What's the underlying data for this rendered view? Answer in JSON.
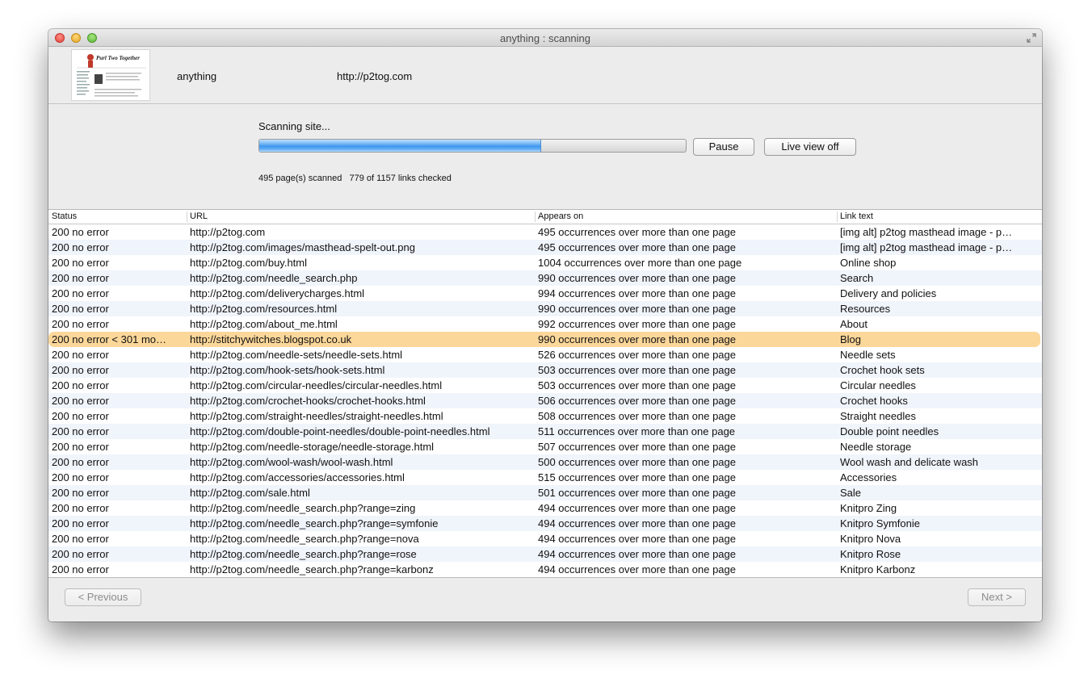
{
  "window": {
    "title": "anything : scanning"
  },
  "project": {
    "name": "anything",
    "url": "http://p2tog.com",
    "thumbnail_heading": "Purl Two Together"
  },
  "scan": {
    "status_label": "Scanning site...",
    "progress": 0.66,
    "pause_label": "Pause",
    "live_view_label": "Live view off",
    "stats": "495 page(s) scanned   779 of 1157 links checked"
  },
  "table": {
    "columns": [
      "Status",
      "URL",
      "Appears on",
      "Link text"
    ],
    "selected_row": 7,
    "rows": [
      {
        "status": "200 no error",
        "url": "http://p2tog.com",
        "appears": "495 occurrences over more than one page",
        "text": "[img alt] p2tog masthead image - p…"
      },
      {
        "status": "200 no error",
        "url": "http://p2tog.com/images/masthead-spelt-out.png",
        "appears": "495 occurrences over more than one page",
        "text": "[img alt] p2tog masthead image - p…"
      },
      {
        "status": "200 no error",
        "url": "http://p2tog.com/buy.html",
        "appears": "1004 occurrences over more than one page",
        "text": "Online shop"
      },
      {
        "status": "200 no error",
        "url": "http://p2tog.com/needle_search.php",
        "appears": "990 occurrences over more than one page",
        "text": "Search"
      },
      {
        "status": "200 no error",
        "url": "http://p2tog.com/deliverycharges.html",
        "appears": "994 occurrences over more than one page",
        "text": "Delivery and policies"
      },
      {
        "status": "200 no error",
        "url": "http://p2tog.com/resources.html",
        "appears": "990 occurrences over more than one page",
        "text": "Resources"
      },
      {
        "status": "200 no error",
        "url": "http://p2tog.com/about_me.html",
        "appears": "992 occurrences over more than one page",
        "text": "About"
      },
      {
        "status": "200 no error < 301 mo…",
        "url": "http://stitchywitches.blogspot.co.uk",
        "appears": "990 occurrences over more than one page",
        "text": "Blog"
      },
      {
        "status": "200 no error",
        "url": "http://p2tog.com/needle-sets/needle-sets.html",
        "appears": "526 occurrences over more than one page",
        "text": "Needle sets"
      },
      {
        "status": "200 no error",
        "url": "http://p2tog.com/hook-sets/hook-sets.html",
        "appears": "503 occurrences over more than one page",
        "text": "Crochet hook sets"
      },
      {
        "status": "200 no error",
        "url": "http://p2tog.com/circular-needles/circular-needles.html",
        "appears": "503 occurrences over more than one page",
        "text": "Circular needles"
      },
      {
        "status": "200 no error",
        "url": "http://p2tog.com/crochet-hooks/crochet-hooks.html",
        "appears": "506 occurrences over more than one page",
        "text": "Crochet hooks"
      },
      {
        "status": "200 no error",
        "url": "http://p2tog.com/straight-needles/straight-needles.html",
        "appears": "508 occurrences over more than one page",
        "text": "Straight needles"
      },
      {
        "status": "200 no error",
        "url": "http://p2tog.com/double-point-needles/double-point-needles.html",
        "appears": "511 occurrences over more than one page",
        "text": "Double point needles"
      },
      {
        "status": "200 no error",
        "url": "http://p2tog.com/needle-storage/needle-storage.html",
        "appears": "507 occurrences over more than one page",
        "text": "Needle storage"
      },
      {
        "status": "200 no error",
        "url": "http://p2tog.com/wool-wash/wool-wash.html",
        "appears": "500 occurrences over more than one page",
        "text": "Wool wash and delicate wash"
      },
      {
        "status": "200 no error",
        "url": "http://p2tog.com/accessories/accessories.html",
        "appears": "515 occurrences over more than one page",
        "text": "Accessories"
      },
      {
        "status": "200 no error",
        "url": "http://p2tog.com/sale.html",
        "appears": "501 occurrences over more than one page",
        "text": "Sale"
      },
      {
        "status": "200 no error",
        "url": "http://p2tog.com/needle_search.php?range=zing",
        "appears": "494 occurrences over more than one page",
        "text": "Knitpro Zing"
      },
      {
        "status": "200 no error",
        "url": "http://p2tog.com/needle_search.php?range=symfonie",
        "appears": "494 occurrences over more than one page",
        "text": "Knitpro Symfonie"
      },
      {
        "status": "200 no error",
        "url": "http://p2tog.com/needle_search.php?range=nova",
        "appears": "494 occurrences over more than one page",
        "text": "Knitpro Nova"
      },
      {
        "status": "200 no error",
        "url": "http://p2tog.com/needle_search.php?range=rose",
        "appears": "494 occurrences over more than one page",
        "text": "Knitpro Rose"
      },
      {
        "status": "200 no error",
        "url": "http://p2tog.com/needle_search.php?range=karbonz",
        "appears": "494 occurrences over more than one page",
        "text": "Knitpro Karbonz"
      }
    ]
  },
  "footer": {
    "previous_label": "< Previous",
    "next_label": "Next >"
  },
  "colors": {
    "selection": "#fcd79a",
    "alt_row": "#f0f4fb",
    "progress_blue": "#3f97ef"
  }
}
